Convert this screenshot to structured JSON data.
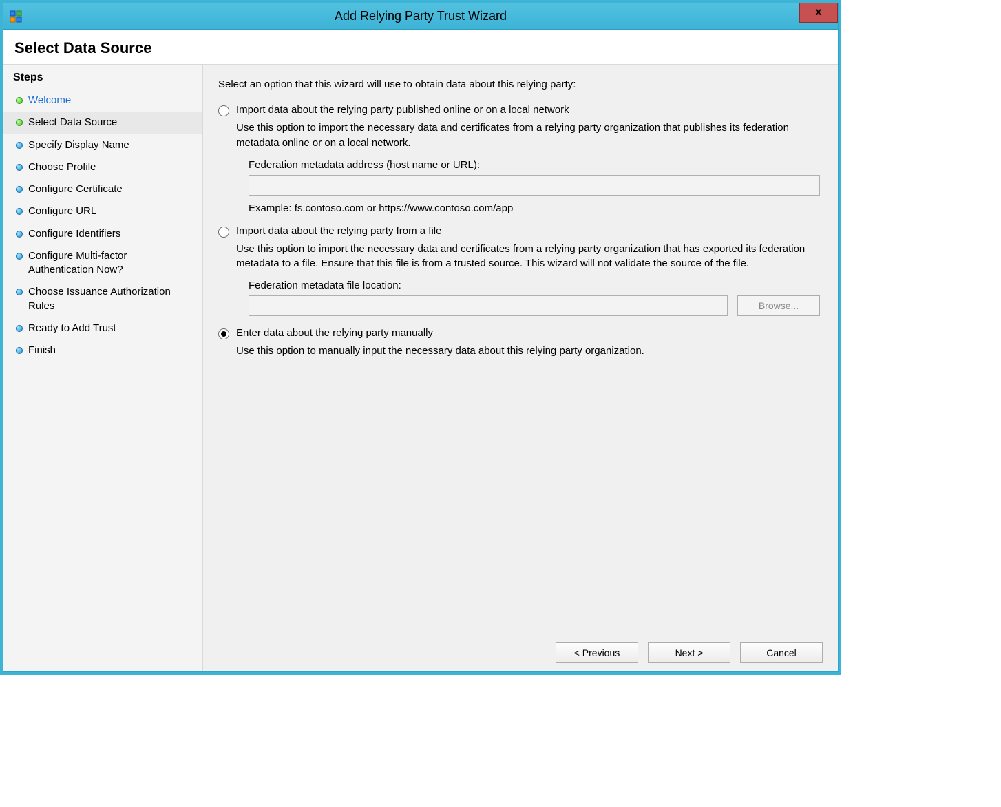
{
  "window": {
    "title": "Add Relying Party Trust Wizard"
  },
  "header": {
    "title": "Select Data Source"
  },
  "sidebar": {
    "heading": "Steps",
    "items": [
      {
        "label": "Welcome",
        "kind": "link",
        "bullet": "green"
      },
      {
        "label": "Select Data Source",
        "kind": "current",
        "bullet": "green"
      },
      {
        "label": "Specify Display Name",
        "kind": "pending",
        "bullet": "blue"
      },
      {
        "label": "Choose Profile",
        "kind": "pending",
        "bullet": "blue"
      },
      {
        "label": "Configure Certificate",
        "kind": "pending",
        "bullet": "blue"
      },
      {
        "label": "Configure URL",
        "kind": "pending",
        "bullet": "blue"
      },
      {
        "label": "Configure Identifiers",
        "kind": "pending",
        "bullet": "blue"
      },
      {
        "label": "Configure Multi-factor Authentication Now?",
        "kind": "pending",
        "bullet": "blue"
      },
      {
        "label": "Choose Issuance Authorization Rules",
        "kind": "pending",
        "bullet": "blue"
      },
      {
        "label": "Ready to Add Trust",
        "kind": "pending",
        "bullet": "blue"
      },
      {
        "label": "Finish",
        "kind": "pending",
        "bullet": "blue"
      }
    ]
  },
  "content": {
    "prompt": "Select an option that this wizard will use to obtain data about this relying party:",
    "options": {
      "online": {
        "label": "Import data about the relying party published online or on a local network",
        "description": "Use this option to import the necessary data and certificates from a relying party organization that publishes its federation metadata online or on a local network.",
        "address_label": "Federation metadata address (host name or URL):",
        "address_value": "",
        "example": "Example: fs.contoso.com or https://www.contoso.com/app",
        "selected": false
      },
      "file": {
        "label": "Import data about the relying party from a file",
        "description": "Use this option to import the necessary data and certificates from a relying party organization that has exported its federation metadata to a file. Ensure that this file is from a trusted source.  This wizard will not validate the source of the file.",
        "location_label": "Federation metadata file location:",
        "location_value": "",
        "browse_label": "Browse...",
        "selected": false
      },
      "manual": {
        "label": "Enter data about the relying party manually",
        "description": "Use this option to manually input the necessary data about this relying party organization.",
        "selected": true
      }
    }
  },
  "buttons": {
    "previous": "< Previous",
    "next": "Next >",
    "cancel": "Cancel"
  }
}
